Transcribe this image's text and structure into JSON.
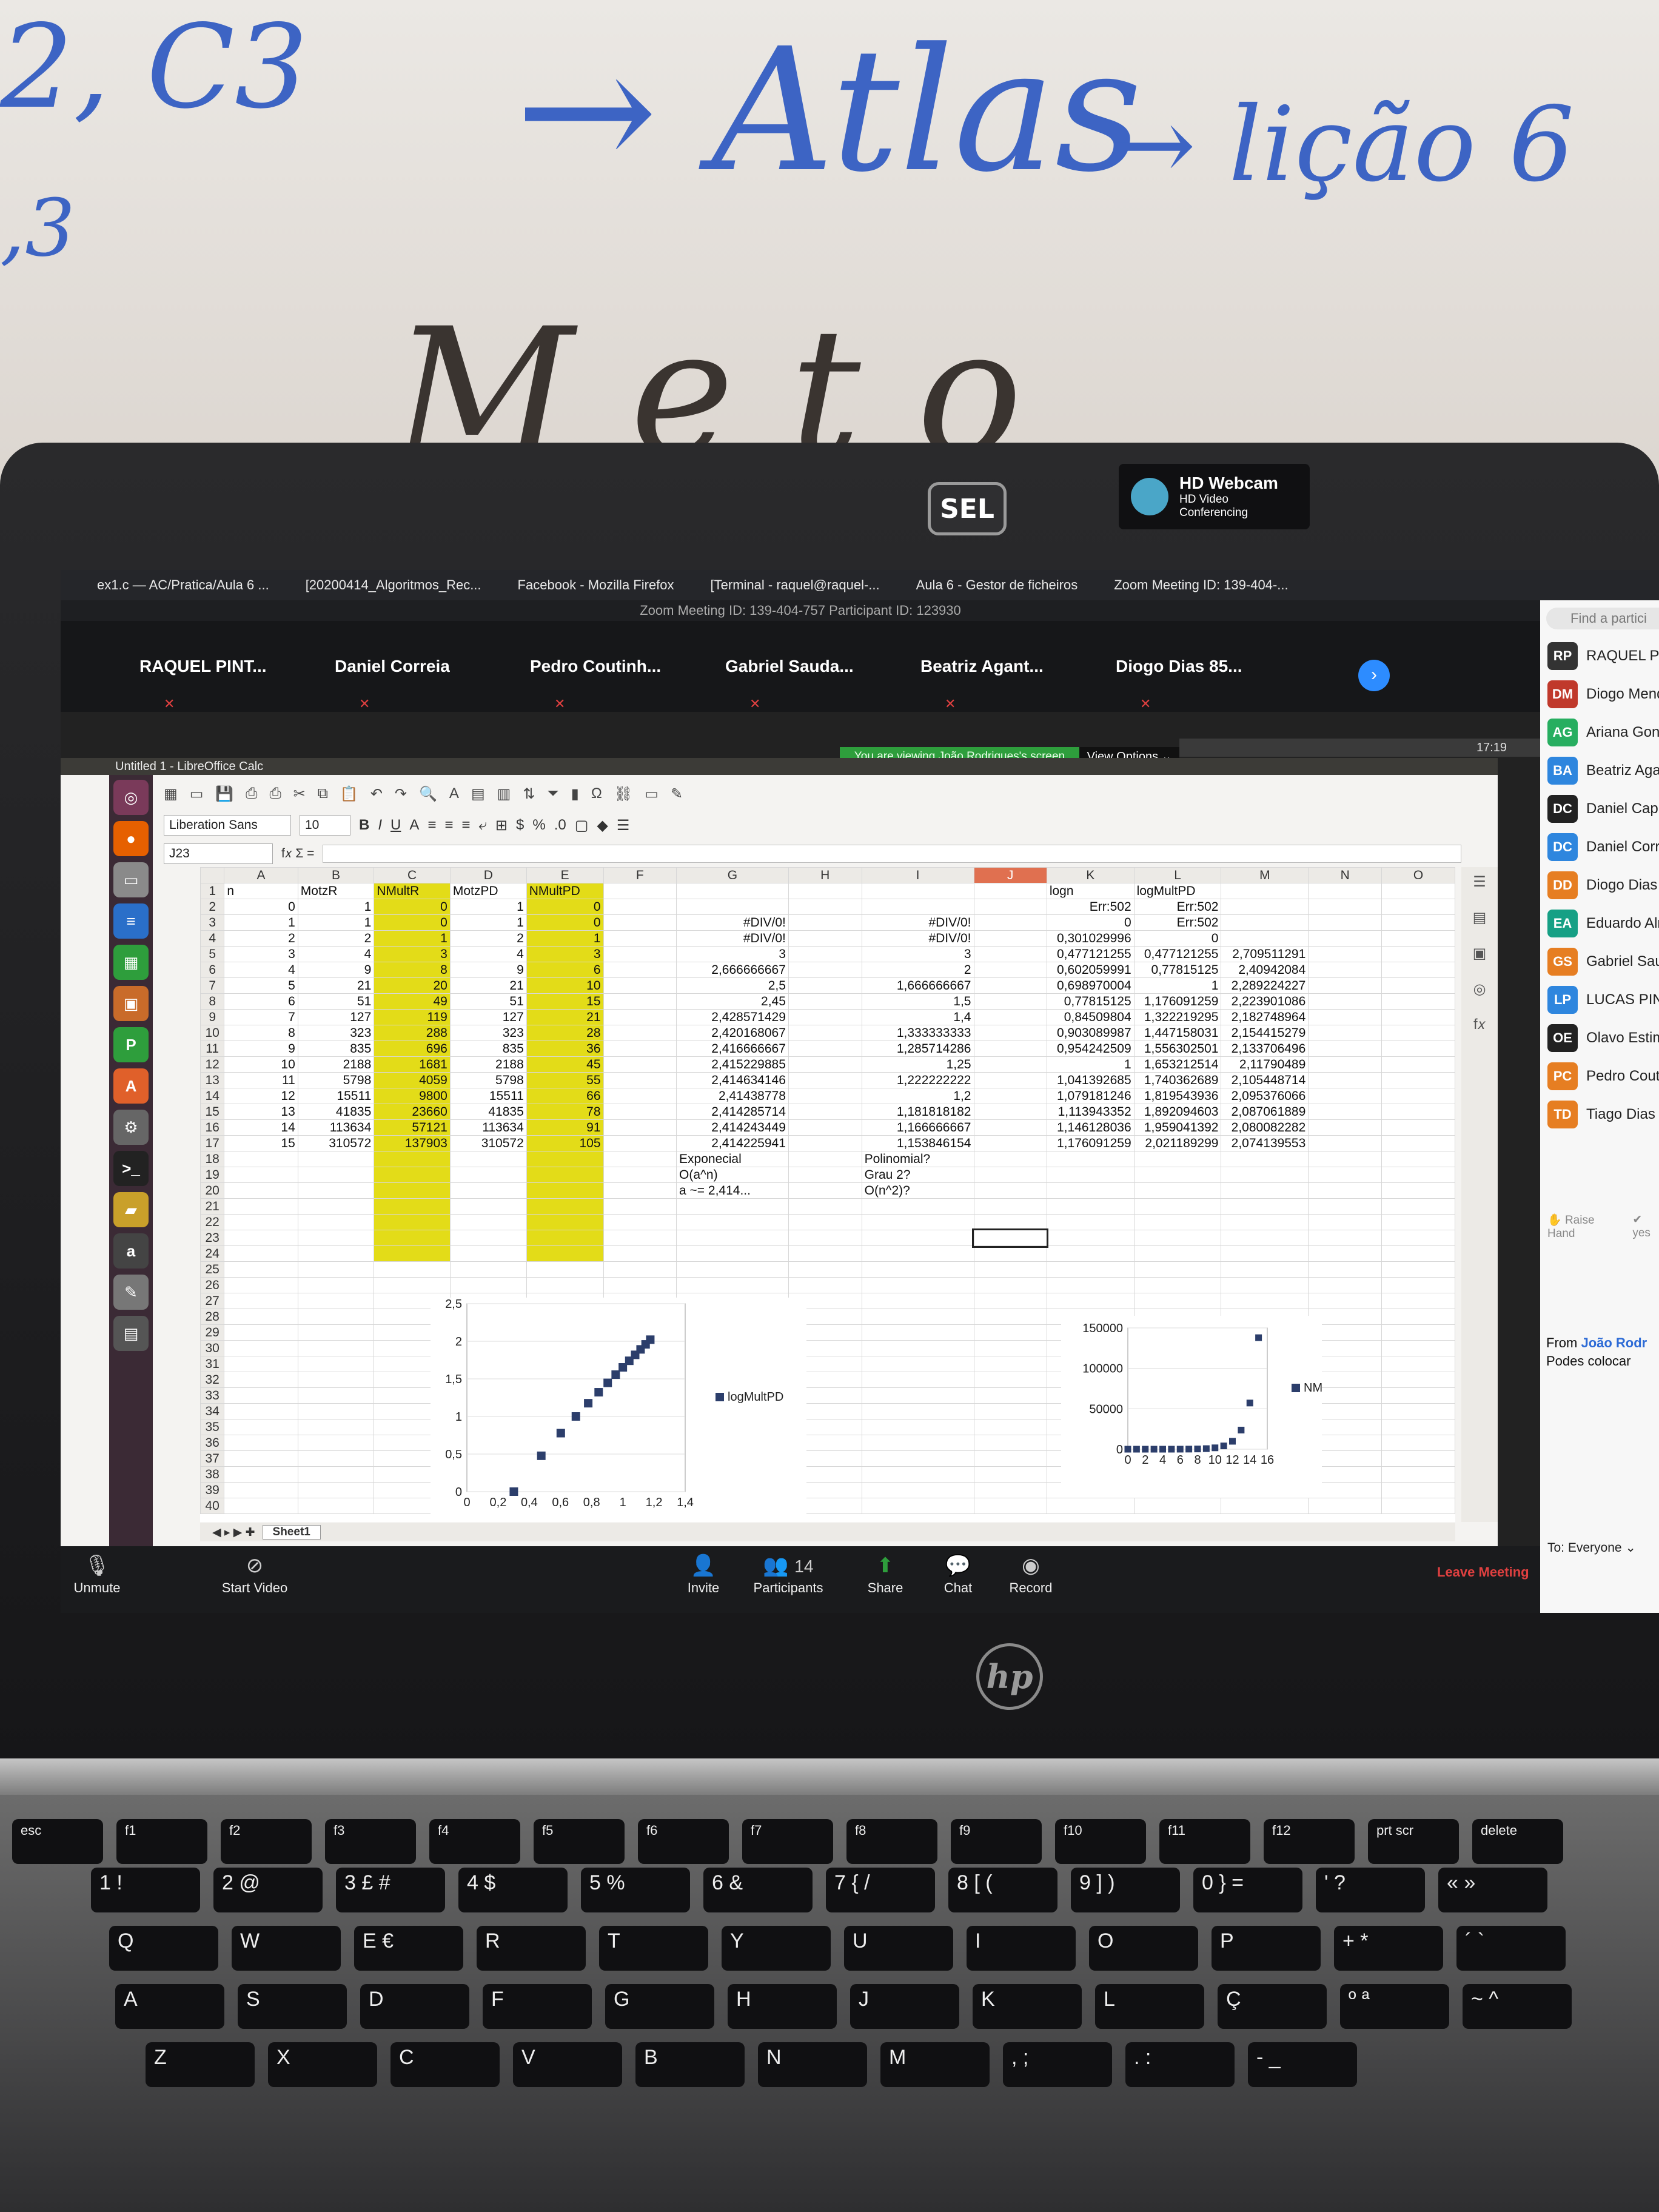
{
  "whiteboard": {
    "left_scribble": "2, C3",
    "left_scribble_2": ",3",
    "center_scribble": "→ Atlas",
    "right_scribble": "→ lição 6",
    "bottom_scribble": "M e  t o"
  },
  "webcam": {
    "brand": "SEL",
    "title": "HD Webcam",
    "subtitle": "HD Video Conferencing"
  },
  "taskbar": {
    "items": [
      "ex1.c — AC/Pratica/Aula 6 ...",
      "[20200414_Algoritmos_Rec...",
      "Facebook - Mozilla Firefox",
      "[Terminal - raquel@raquel-...",
      "Aula 6 - Gestor de ficheiros",
      "Zoom Meeting ID: 139-404-..."
    ]
  },
  "zoom": {
    "title": "Zoom Meeting ID: 139-404-757 Participant ID: 123930",
    "gallery": [
      "RAQUEL PINT...",
      "Daniel Correia",
      "Pedro Coutinh...",
      "Gabriel Sauda...",
      "Beatriz Agant...",
      "Diogo Dias 85..."
    ],
    "banner": "You are viewing João Rodrigues's screen",
    "view_options": "View Options ⌄",
    "clock": "17:19",
    "toolbar": {
      "unmute": "Unmute",
      "start_video": "Start Video",
      "invite": "Invite",
      "participants": "Participants",
      "participants_count": "14",
      "share": "Share",
      "chat": "Chat",
      "record": "Record",
      "leave": "Leave Meeting"
    },
    "panel": {
      "search": "Find a partici",
      "participants": [
        {
          "initials": "RP",
          "name": "RAQUEL PIN",
          "color": "#333333"
        },
        {
          "initials": "DM",
          "name": "Diogo Mend",
          "color": "#c0392b"
        },
        {
          "initials": "AG",
          "name": "Ariana Gonç",
          "color": "#27ae60"
        },
        {
          "initials": "BA",
          "name": "Beatriz Aga",
          "color": "#2e86de"
        },
        {
          "initials": "DC",
          "name": "Daniel Capi",
          "color": "#222222"
        },
        {
          "initials": "DC",
          "name": "Daniel Corr",
          "color": "#2e86de"
        },
        {
          "initials": "DD",
          "name": "Diogo Dias",
          "color": "#e67e22"
        },
        {
          "initials": "EA",
          "name": "Eduardo Alm",
          "color": "#16a085"
        },
        {
          "initials": "GS",
          "name": "Gabriel Sau",
          "color": "#e67e22"
        },
        {
          "initials": "LP",
          "name": "LUCAS PINH",
          "color": "#2e86de"
        },
        {
          "initials": "OE",
          "name": "Olavo Estim",
          "color": "#222222"
        },
        {
          "initials": "PC",
          "name": "Pedro Cout",
          "color": "#e67e22"
        },
        {
          "initials": "TD",
          "name": "Tiago Dias",
          "color": "#e67e22"
        }
      ],
      "raise_hand": "Raise Hand",
      "yes": "yes",
      "chat_from": "From",
      "chat_sender": "João Rodr",
      "chat_text": "Podes colocar",
      "to_label": "To:",
      "to_value": "Everyone"
    }
  },
  "calc": {
    "title": "Untitled 1 - LibreOffice Calc",
    "font_name": "Liberation Sans",
    "font_size": "10",
    "cell_ref": "J23",
    "fx": "f𝑥  Σ  =",
    "sheet_tab": "Sheet1",
    "columns": [
      "A",
      "B",
      "C",
      "D",
      "E",
      "F",
      "G",
      "H",
      "I",
      "J",
      "K",
      "L",
      "M",
      "N",
      "O"
    ],
    "headers": {
      "A": "n",
      "B": "MotzR",
      "C": "NMultR",
      "D": "MotzPD",
      "E": "NMultPD",
      "K": "logn",
      "L": "logMultPD"
    },
    "rows": [
      {
        "A": "0",
        "B": "1",
        "C": "0",
        "D": "1",
        "E": "0",
        "G": "",
        "I": "",
        "K": "Err:502",
        "L": "Err:502",
        "M": ""
      },
      {
        "A": "1",
        "B": "1",
        "C": "0",
        "D": "1",
        "E": "0",
        "G": "#DIV/0!",
        "I": "#DIV/0!",
        "K": "0",
        "L": "Err:502",
        "M": ""
      },
      {
        "A": "2",
        "B": "2",
        "C": "1",
        "D": "2",
        "E": "1",
        "G": "#DIV/0!",
        "I": "#DIV/0!",
        "K": "0,301029996",
        "L": "0",
        "M": ""
      },
      {
        "A": "3",
        "B": "4",
        "C": "3",
        "D": "4",
        "E": "3",
        "G": "3",
        "I": "3",
        "K": "0,477121255",
        "L": "0,477121255",
        "M": "2,709511291"
      },
      {
        "A": "4",
        "B": "9",
        "C": "8",
        "D": "9",
        "E": "6",
        "G": "2,666666667",
        "I": "2",
        "K": "0,602059991",
        "L": "0,77815125",
        "M": "2,40942084"
      },
      {
        "A": "5",
        "B": "21",
        "C": "20",
        "D": "21",
        "E": "10",
        "G": "2,5",
        "I": "1,666666667",
        "K": "0,698970004",
        "L": "1",
        "M": "2,289224227"
      },
      {
        "A": "6",
        "B": "51",
        "C": "49",
        "D": "51",
        "E": "15",
        "G": "2,45",
        "I": "1,5",
        "K": "0,77815125",
        "L": "1,176091259",
        "M": "2,223901086"
      },
      {
        "A": "7",
        "B": "127",
        "C": "119",
        "D": "127",
        "E": "21",
        "G": "2,428571429",
        "I": "1,4",
        "K": "0,84509804",
        "L": "1,322219295",
        "M": "2,182748964"
      },
      {
        "A": "8",
        "B": "323",
        "C": "288",
        "D": "323",
        "E": "28",
        "G": "2,420168067",
        "I": "1,333333333",
        "K": "0,903089987",
        "L": "1,447158031",
        "M": "2,154415279"
      },
      {
        "A": "9",
        "B": "835",
        "C": "696",
        "D": "835",
        "E": "36",
        "G": "2,416666667",
        "I": "1,285714286",
        "K": "0,954242509",
        "L": "1,556302501",
        "M": "2,133706496"
      },
      {
        "A": "10",
        "B": "2188",
        "C": "1681",
        "D": "2188",
        "E": "45",
        "G": "2,415229885",
        "I": "1,25",
        "K": "1",
        "L": "1,653212514",
        "M": "2,11790489"
      },
      {
        "A": "11",
        "B": "5798",
        "C": "4059",
        "D": "5798",
        "E": "55",
        "G": "2,414634146",
        "I": "1,222222222",
        "K": "1,041392685",
        "L": "1,740362689",
        "M": "2,105448714"
      },
      {
        "A": "12",
        "B": "15511",
        "C": "9800",
        "D": "15511",
        "E": "66",
        "G": "2,41438778",
        "I": "1,2",
        "K": "1,079181246",
        "L": "1,819543936",
        "M": "2,095376066"
      },
      {
        "A": "13",
        "B": "41835",
        "C": "23660",
        "D": "41835",
        "E": "78",
        "G": "2,414285714",
        "I": "1,181818182",
        "K": "1,113943352",
        "L": "1,892094603",
        "M": "2,087061889"
      },
      {
        "A": "14",
        "B": "113634",
        "C": "57121",
        "D": "113634",
        "E": "91",
        "G": "2,414243449",
        "I": "1,166666667",
        "K": "1,146128036",
        "L": "1,959041392",
        "M": "2,080082282"
      },
      {
        "A": "15",
        "B": "310572",
        "C": "137903",
        "D": "310572",
        "E": "105",
        "G": "2,414225941",
        "I": "1,153846154",
        "K": "1,176091259",
        "L": "2,021189299",
        "M": "2,074139553"
      }
    ],
    "notes": {
      "g18": "Exponecial",
      "g19": "O(a^n)",
      "g20": "a ~= 2,414...",
      "i18": "Polinomial?",
      "i19": "Grau 2?",
      "i20": "O(n^2)?"
    }
  },
  "chart_data": [
    {
      "type": "scatter",
      "series": [
        {
          "name": "logMultPD",
          "x": [
            0,
            0.301029996,
            0.477121255,
            0.602059991,
            0.698970004,
            0.77815125,
            0.84509804,
            0.903089987,
            0.954242509,
            1,
            1.041392685,
            1.079181246,
            1.113943352,
            1.146128036,
            1.176091259
          ],
          "y": [
            null,
            0,
            0.477121255,
            0.77815125,
            1,
            1.176091259,
            1.322219295,
            1.447158031,
            1.556302501,
            1.653212514,
            1.740362689,
            1.819543936,
            1.892094603,
            1.959041392,
            2.021189299
          ]
        }
      ],
      "xlim": [
        0,
        1.4
      ],
      "ylim": [
        0,
        2.5
      ],
      "xticks": [
        "0",
        "0,2",
        "0,4",
        "0,6",
        "0,8",
        "1",
        "1,2",
        "1,4"
      ],
      "yticks": [
        "0",
        "0,5",
        "1",
        "1,5",
        "2",
        "2,5"
      ],
      "legend": "right"
    },
    {
      "type": "scatter",
      "series": [
        {
          "name": "NMultR",
          "x": [
            0,
            1,
            2,
            3,
            4,
            5,
            6,
            7,
            8,
            9,
            10,
            11,
            12,
            13,
            14,
            15
          ],
          "y": [
            0,
            0,
            1,
            3,
            8,
            20,
            49,
            119,
            288,
            696,
            1681,
            4059,
            9800,
            23660,
            57121,
            137903
          ]
        }
      ],
      "xlim": [
        0,
        16
      ],
      "ylim": [
        0,
        150000
      ],
      "xticks": [
        "0",
        "2",
        "4",
        "6",
        "8",
        "10",
        "12",
        "14",
        "16"
      ],
      "yticks": [
        "0",
        "50000",
        "100000",
        "150000"
      ],
      "legend": "right"
    }
  ],
  "keyboard": {
    "row1": [
      "esc",
      "f1",
      "f2",
      "f3",
      "f4",
      "f5",
      "f6",
      "f7",
      "f8",
      "f9",
      "f10",
      "f11",
      "f12",
      "prt scr",
      "delete"
    ],
    "row2": [
      "1 !",
      "2 @",
      "3 £ #",
      "4 $",
      "5 %",
      "6 &",
      "7 { /",
      "8 [ (",
      "9 ] )",
      "0 } =",
      "' ?",
      "« »"
    ],
    "row3": [
      "Q",
      "W",
      "E €",
      "R",
      "T",
      "Y",
      "U",
      "I",
      "O",
      "P",
      "+ *",
      "´ `"
    ],
    "row4": [
      "A",
      "S",
      "D",
      "F",
      "G",
      "H",
      "J",
      "K",
      "L",
      "Ç",
      "º ª",
      "~ ^"
    ],
    "row5": [
      "Z",
      "X",
      "C",
      "V",
      "B",
      "N",
      "M",
      ", ;",
      ". :",
      "- _"
    ]
  }
}
